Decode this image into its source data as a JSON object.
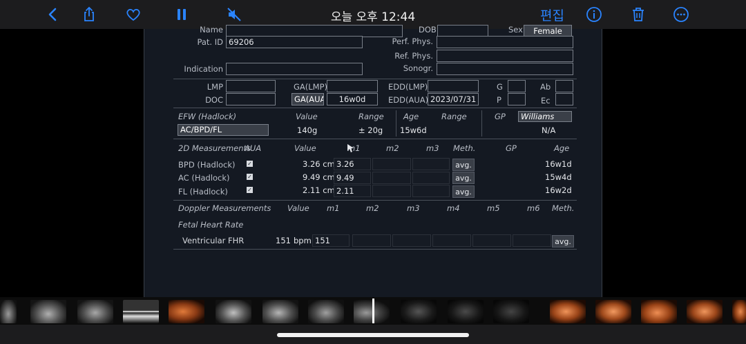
{
  "topbar": {
    "title": "오늘 오후 12:44",
    "edit_label": "편집"
  },
  "patient": {
    "name_label": "Name",
    "dob_label": "DOB",
    "sex_label": "Sex",
    "sex_value": "Female",
    "patid_label": "Pat. ID",
    "patid_value": "69206",
    "perf_phys_label": "Perf. Phys.",
    "ref_phys_label": "Ref. Phys.",
    "indication_label": "Indication",
    "sonogr_label": "Sonogr."
  },
  "dating": {
    "lmp_label": "LMP",
    "ga_lmp_label": "GA(LMP)",
    "edd_lmp_label": "EDD(LMP)",
    "g_label": "G",
    "ab_label": "Ab",
    "doc_label": "DOC",
    "ga_aua_label": "GA(AUA)",
    "ga_aua_value": "16w0d",
    "edd_aua_label": "EDD(AUA)",
    "edd_aua_value": "2023/07/31",
    "p_label": "P",
    "ec_label": "Ec"
  },
  "efw": {
    "header": "EFW (Hadlock)",
    "value_header": "Value",
    "range_header": "Range",
    "age_header": "Age",
    "range2_header": "Range",
    "gp_header": "GP",
    "gp_value": "Williams",
    "formula": "AC/BPD/FL",
    "value": "140g",
    "range": "± 20g",
    "age": "15w6d",
    "gp_result": "N/A"
  },
  "measurements_2d": {
    "headers": {
      "title": "2D Measurements",
      "aua": "AUA",
      "value": "Value",
      "m1": "m1",
      "m2": "m2",
      "m3": "m3",
      "meth": "Meth.",
      "gp": "GP",
      "age": "Age"
    },
    "avg_label": "avg.",
    "rows": [
      {
        "name": "BPD (Hadlock)",
        "value": "3.26 cm",
        "m1": "3.26",
        "age": "16w1d"
      },
      {
        "name": "AC (Hadlock)",
        "value": "9.49 cm",
        "m1": "9.49",
        "age": "15w4d"
      },
      {
        "name": "FL (Hadlock)",
        "value": "2.11 cm",
        "m1": "2.11",
        "age": "16w2d"
      }
    ]
  },
  "doppler": {
    "headers": {
      "title": "Doppler Measurements",
      "value": "Value",
      "m1": "m1",
      "m2": "m2",
      "m3": "m3",
      "m4": "m4",
      "m5": "m5",
      "m6": "m6",
      "meth": "Meth."
    },
    "section": "Fetal Heart Rate",
    "row_name": "Ventricular FHR",
    "row_value": "151",
    "row_unit": "bpm",
    "row_m1": "151",
    "avg_label": "avg."
  },
  "icons": [
    "back-icon",
    "share-icon",
    "heart-icon",
    "pause-icon",
    "mute-icon",
    "info-icon",
    "trash-icon",
    "more-icon"
  ],
  "colors": {
    "accent": "#2a84ff",
    "screen_bg": "#141922"
  }
}
